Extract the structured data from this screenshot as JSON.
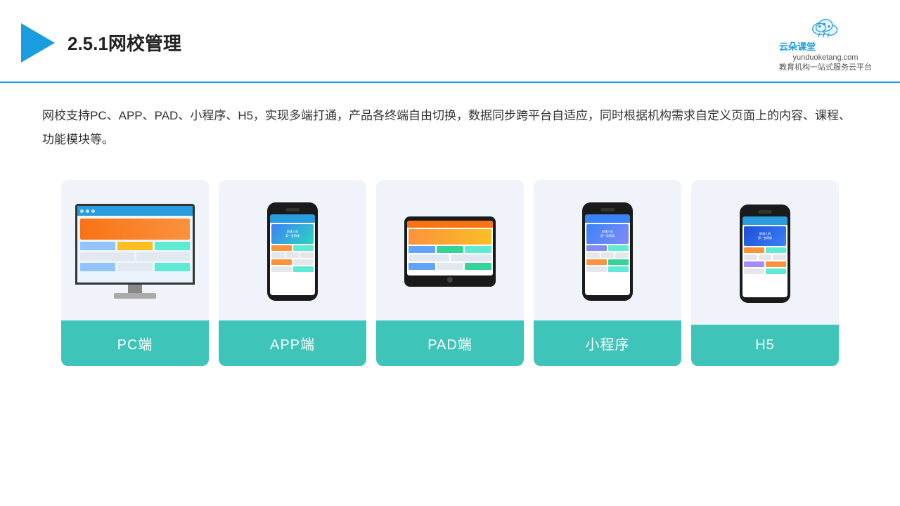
{
  "header": {
    "title": "2.5.1网校管理",
    "brand": {
      "name": "云朵课堂",
      "url": "yunduoketang.com",
      "tagline": "教育机构一站式服务云平台"
    }
  },
  "description": "网校支持PC、APP、PAD、小程序、H5，实现多端打通，产品各终端自由切换，数据同步跨平台自适应，同时根据机构需求自定义页面上的内容、课程、功能模块等。",
  "cards": [
    {
      "id": "pc",
      "label": "PC端"
    },
    {
      "id": "app",
      "label": "APP端"
    },
    {
      "id": "pad",
      "label": "PAD端"
    },
    {
      "id": "miniapp",
      "label": "小程序"
    },
    {
      "id": "h5",
      "label": "H5"
    }
  ],
  "colors": {
    "accent": "#2196f3",
    "teal": "#3ec4b8",
    "brand": "#1a9de0"
  }
}
